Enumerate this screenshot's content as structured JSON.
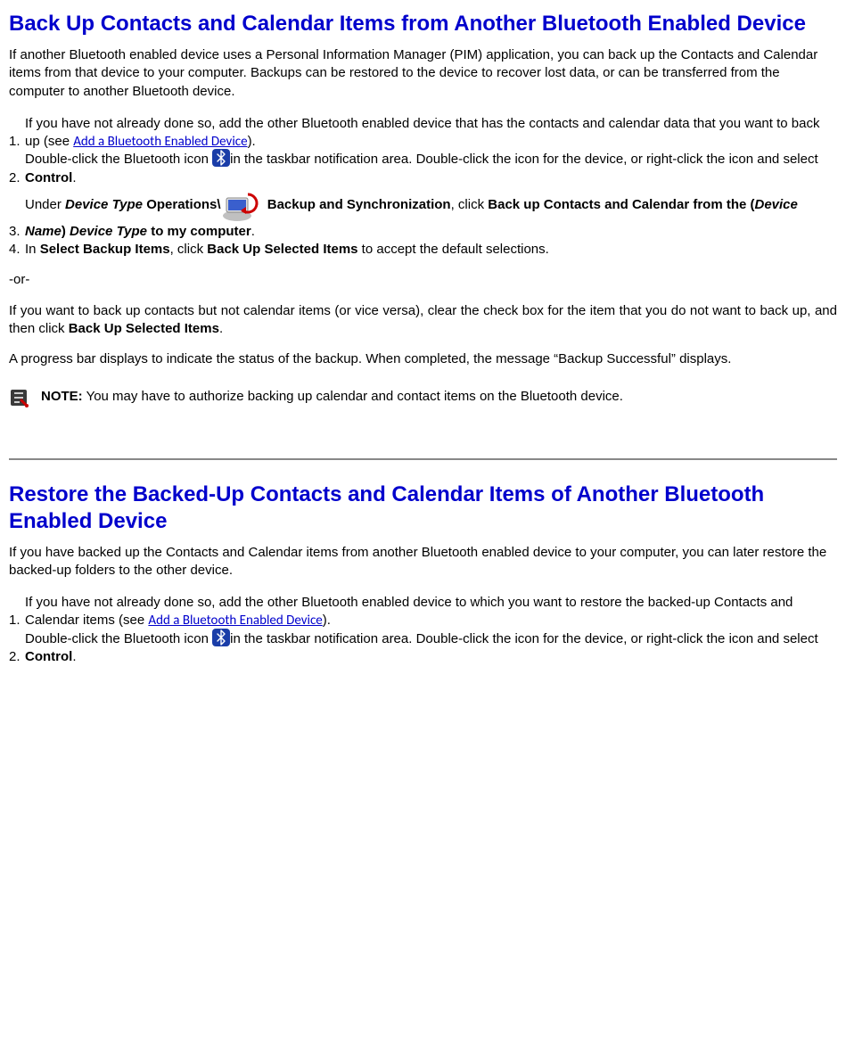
{
  "section1": {
    "title": "Back Up Contacts and Calendar Items from Another Bluetooth Enabled Device",
    "intro": "If another Bluetooth enabled device uses a Personal Information Manager (PIM) application, you can back up the Contacts and Calendar items from that device to your computer. Backups can be restored to the device to recover lost data, or can be transferred from the computer to another Bluetooth device.",
    "steps": {
      "n1": "1.",
      "s1_a": "If you have not already done so, add the other Bluetooth enabled device that has the contacts and calendar data that you want to back up (see ",
      "s1_link": "Add a Bluetooth Enabled Device",
      "s1_b": ").",
      "n2": "2.",
      "s2_a": "Double-click the Bluetooth icon ",
      "s2_b": "in the taskbar notification area. Double-click the icon for the device, or right-click the icon and select ",
      "s2_bold": "Control",
      "s2_c": ".",
      "n3": "3.",
      "s3_a": "Under ",
      "s3_bi1": "Device Type",
      "s3_b": " Operations\\",
      "s3_c": " Backup and Synchronization",
      "s3_d": ", click ",
      "s3_e": "Back up Contacts and Calendar from the (",
      "s3_bi2": "Device Name",
      "s3_f": ") ",
      "s3_bi3": "Device Type",
      "s3_g": " to my computer",
      "s3_h": ".",
      "n4": "4.",
      "s4_a": "In ",
      "s4_b": "Select Backup Items",
      "s4_c": ", click ",
      "s4_d": "Back Up Selected Items",
      "s4_e": " to accept the default selections."
    },
    "or": "-or-",
    "alt_a": "If you want to back up contacts but not calendar items (or vice versa), clear the check box for the item that you do not want to back up, and then click ",
    "alt_b": "Back Up Selected Items",
    "alt_c": ".",
    "progress": "A progress bar displays to indicate the status of the backup. When completed, the message “Backup Successful” displays.",
    "note_label": "NOTE:",
    "note_text": " You may have to authorize backing up calendar and contact items on the Bluetooth device."
  },
  "section2": {
    "title": "Restore the Backed-Up Contacts and Calendar Items of Another Bluetooth Enabled Device",
    "intro": "If you have backed up the Contacts and Calendar items from another Bluetooth enabled device to your computer, you can later restore the backed-up folders to the other device.",
    "steps": {
      "n1": "1.",
      "s1_a": "If you have not already done so, add the other Bluetooth enabled device to which you want to restore the backed-up Contacts and Calendar items (see ",
      "s1_link": "Add a Bluetooth Enabled Device",
      "s1_b": ").",
      "n2": "2.",
      "s2_a": "Double-click the Bluetooth icon ",
      "s2_b": "in the taskbar notification area. Double-click the icon for the device, or right-click the icon and select ",
      "s2_bold": "Control",
      "s2_c": "."
    }
  }
}
